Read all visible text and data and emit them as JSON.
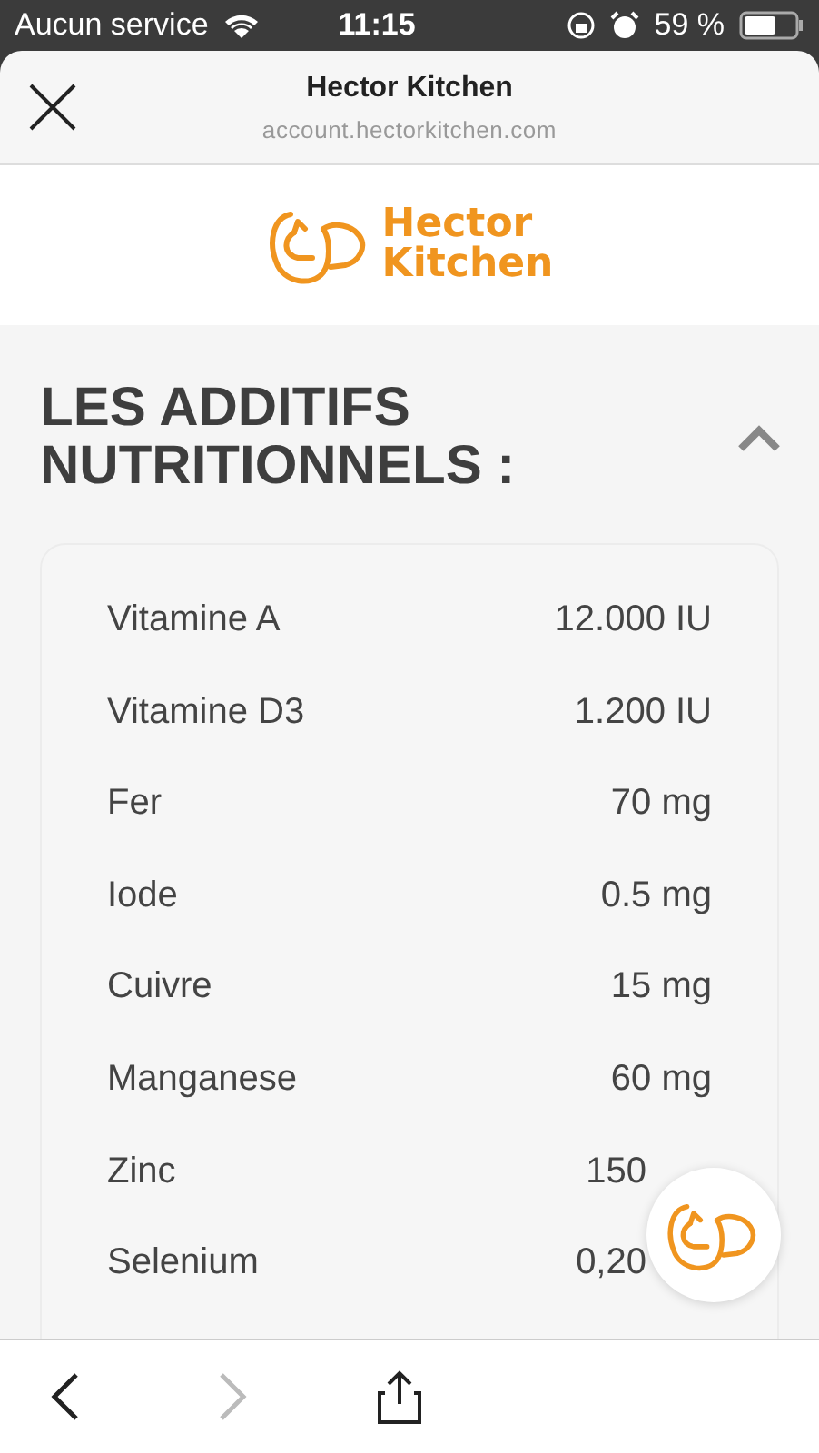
{
  "status_bar": {
    "carrier": "Aucun service",
    "time": "11:15",
    "battery": "59 %"
  },
  "browser": {
    "title": "Hector Kitchen",
    "url": "account.hectorkitchen.com"
  },
  "logo": {
    "line_1": "Hector",
    "line_2": "Kitchen"
  },
  "section": {
    "title": "LES ADDITIFS NUTRITIONNELS :",
    "expanded": true
  },
  "nutrients": [
    {
      "name": "Vitamine A",
      "value": "12.000 IU",
      "partially_hidden": false
    },
    {
      "name": "Vitamine D3",
      "value": "1.200 IU",
      "partially_hidden": false
    },
    {
      "name": "Fer",
      "value": "70 mg",
      "partially_hidden": false
    },
    {
      "name": "Iode",
      "value": "0.5 mg",
      "partially_hidden": false
    },
    {
      "name": "Cuivre",
      "value": "15 mg",
      "partially_hidden": false
    },
    {
      "name": "Manganese",
      "value": "60 mg",
      "partially_hidden": false
    },
    {
      "name": "Zinc",
      "value": "150",
      "partially_hidden": true
    },
    {
      "name": "Selenium",
      "value": "0,20",
      "partially_hidden": true
    }
  ],
  "toolbar": {
    "back_enabled": true,
    "forward_enabled": false
  }
}
